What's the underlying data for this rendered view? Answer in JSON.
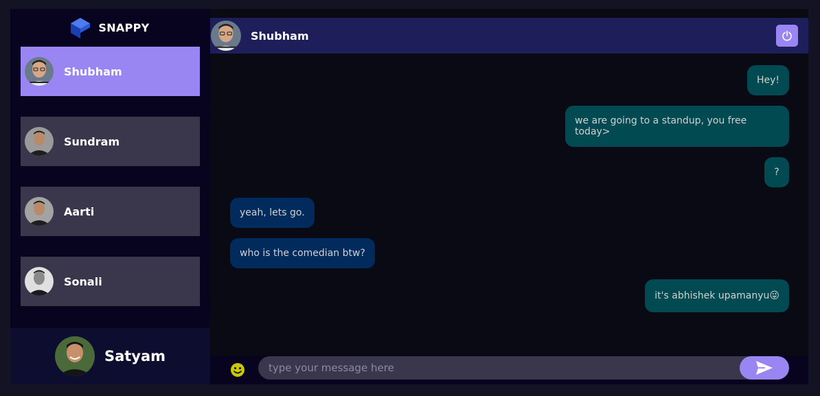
{
  "brand": {
    "name": "SNAPPY",
    "logo_icon": "snappy-logo-icon"
  },
  "contacts": [
    {
      "name": "Shubham",
      "selected": true
    },
    {
      "name": "Sundram",
      "selected": false
    },
    {
      "name": "Aarti",
      "selected": false
    },
    {
      "name": "Sonali",
      "selected": false
    }
  ],
  "current_user": {
    "name": "Satyam"
  },
  "chat": {
    "header_name": "Shubham",
    "logout_icon": "power-icon",
    "messages": [
      {
        "from": "sent",
        "text": "Hey!"
      },
      {
        "from": "sent",
        "text": "we are going to a standup, you free today>"
      },
      {
        "from": "sent",
        "text": "?"
      },
      {
        "from": "recv",
        "text": "yeah, lets go."
      },
      {
        "from": "recv",
        "text": "who is the comedian btw?"
      },
      {
        "from": "sent",
        "text": "it's abhishek upamanyu😜"
      }
    ]
  },
  "input": {
    "placeholder": "type your message here",
    "emoji_icon": "smiley-icon",
    "send_icon": "send-icon"
  },
  "colors": {
    "accent": "#9a86f3",
    "sent_bubble": "#014a52",
    "received_bubble": "#002b5c",
    "sidebar_bg": "#080420",
    "header_bg": "#1e1e5a"
  }
}
